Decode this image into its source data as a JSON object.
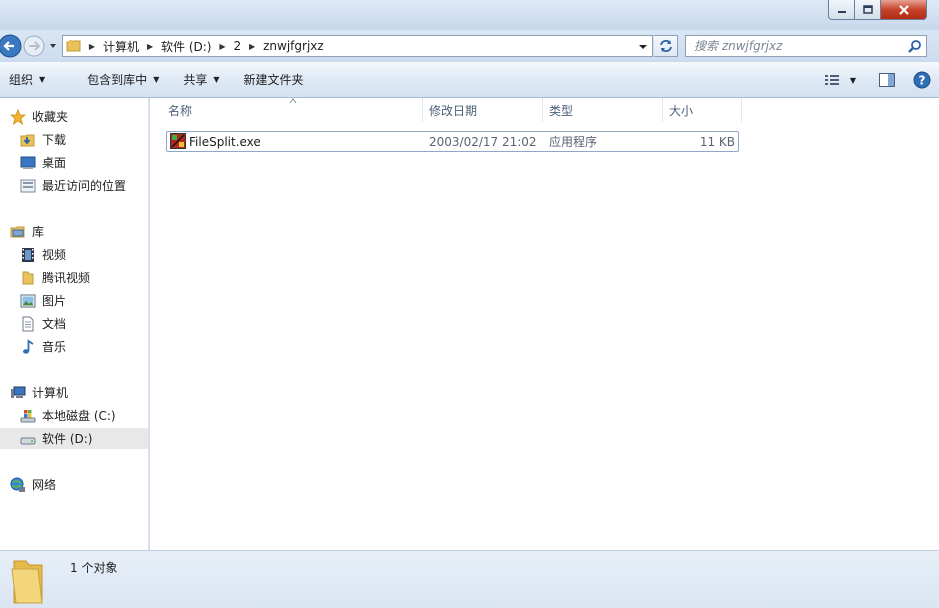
{
  "address": {
    "crumbs": [
      "计算机",
      "软件 (D:)",
      "2",
      "znwjfgrjxz"
    ]
  },
  "search": {
    "placeholder": "搜索 znwjfgrjxz"
  },
  "toolbar": {
    "organize": "组织",
    "include_library": "包含到库中",
    "share": "共享",
    "new_folder": "新建文件夹"
  },
  "nav": {
    "favorites": "收藏夹",
    "downloads": "下载",
    "desktop": "桌面",
    "recent": "最近访问的位置",
    "libraries": "库",
    "videos": "视频",
    "tencent_video": "腾讯视频",
    "pictures": "图片",
    "documents": "文档",
    "music": "音乐",
    "computer": "计算机",
    "drive_c": "本地磁盘 (C:)",
    "drive_d": "软件 (D:)",
    "network": "网络"
  },
  "columns": {
    "name": "名称",
    "modified": "修改日期",
    "type": "类型",
    "size": "大小"
  },
  "files": [
    {
      "name": "FileSplit.exe",
      "modified": "2003/02/17 21:02",
      "type": "应用程序",
      "size": "11 KB"
    }
  ],
  "status": {
    "count_text": "1 个对象"
  },
  "colors": {
    "accent": "#2f6db5",
    "selection_border": "#8fa8c9",
    "close_red": "#c7432c"
  }
}
